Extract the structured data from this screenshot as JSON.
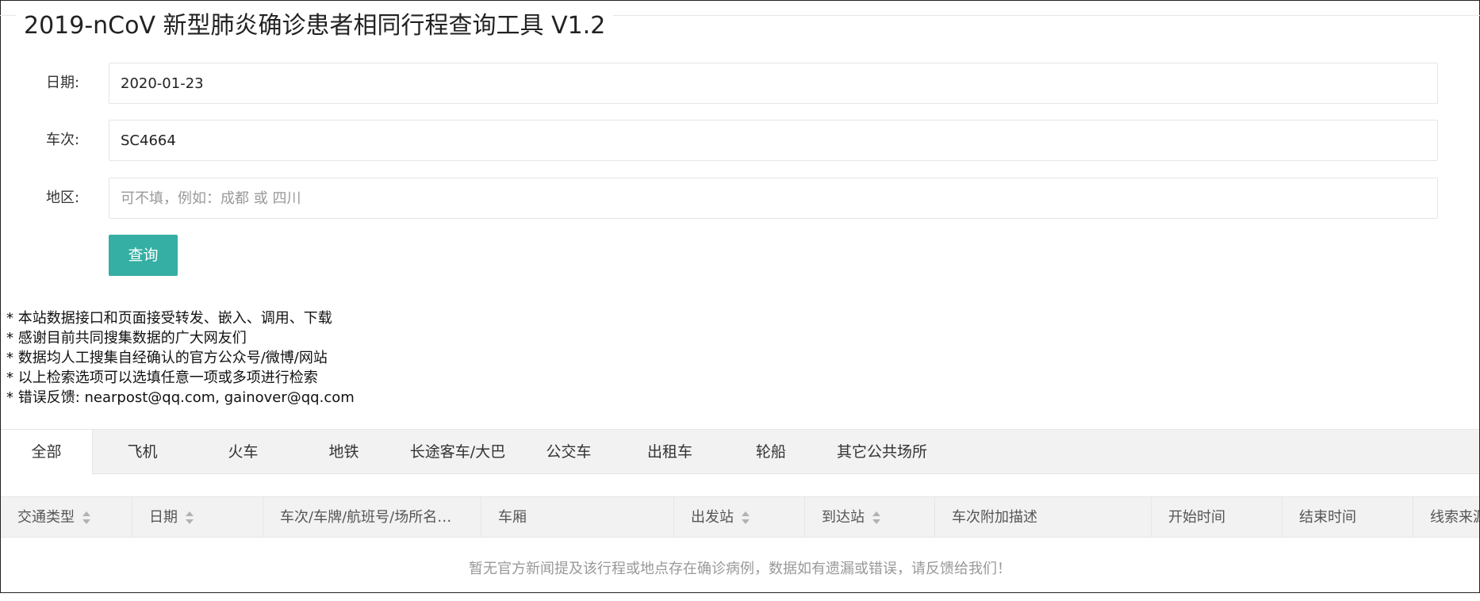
{
  "page": {
    "title": "2019-nCoV 新型肺炎确诊患者相同行程查询工具 V1.2"
  },
  "form": {
    "date_label": "日期:",
    "date_value": "2020-01-23",
    "train_label": "车次:",
    "train_value": "SC4664",
    "region_label": "地区:",
    "region_value": "",
    "region_placeholder": "可不填，例如：成都 或 四川",
    "query_label": "查询"
  },
  "notes": [
    "* 本站数据接口和页面接受转发、嵌入、调用、下载",
    "* 感谢目前共同搜集数据的广大网友们",
    "* 数据均人工搜集自经确认的官方公众号/微博/网站",
    "* 以上检索选项可以选填任意一项或多项进行检索",
    "* 错误反馈: nearpost@qq.com, gainover@qq.com"
  ],
  "tabs": [
    {
      "label": "全部",
      "active": true
    },
    {
      "label": "飞机"
    },
    {
      "label": "火车"
    },
    {
      "label": "地铁"
    },
    {
      "label": "长途客车/大巴"
    },
    {
      "label": "公交车"
    },
    {
      "label": "出租车"
    },
    {
      "label": "轮船"
    },
    {
      "label": "其它公共场所"
    }
  ],
  "table": {
    "columns": [
      {
        "label": "交通类型",
        "sortable": true
      },
      {
        "label": "日期",
        "sortable": true
      },
      {
        "label": "车次/车牌/航班号/场所名…",
        "sortable": false
      },
      {
        "label": "车厢",
        "sortable": false
      },
      {
        "label": "出发站",
        "sortable": true
      },
      {
        "label": "到达站",
        "sortable": true
      },
      {
        "label": "车次附加描述",
        "sortable": false
      },
      {
        "label": "开始时间",
        "sortable": false
      },
      {
        "label": "结束时间",
        "sortable": false
      },
      {
        "label": "线索来源",
        "sortable": false
      }
    ],
    "empty_text": "暂无官方新闻提及该行程或地点存在确诊病例，数据如有遗漏或错误，请反馈给我们！"
  },
  "colors": {
    "accent": "#35aea3",
    "tab_bar": "#f2f2f2",
    "border": "#e6e6e6"
  }
}
